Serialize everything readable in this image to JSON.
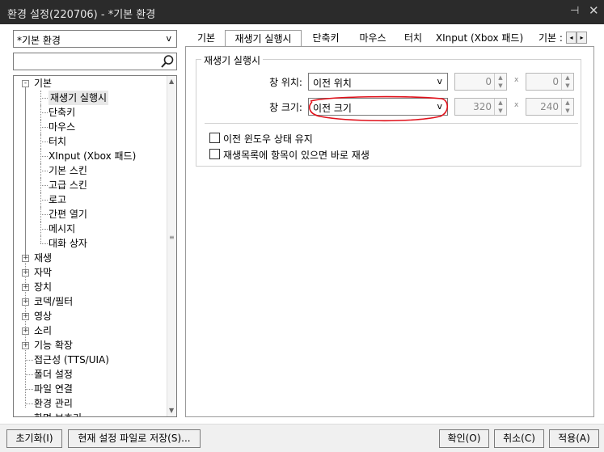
{
  "window": {
    "title": "환경 설정(220706) - *기본 환경",
    "pin_glyph": "⊣",
    "close_glyph": "✕"
  },
  "profile_select": {
    "value": "*기본 환경",
    "arrow": "v"
  },
  "search": {
    "value": "",
    "icon": "search-icon"
  },
  "tree": {
    "root": {
      "toggle": "-",
      "label": "기본"
    },
    "children": [
      "재생기 실행시",
      "단축키",
      "마우스",
      "터치",
      "XInput (Xbox 패드)",
      "기본 스킨",
      "고급 스킨",
      "로고",
      "간편 열기",
      "메시지",
      "대화 상자"
    ],
    "collapsed": [
      "재생",
      "자막",
      "장치",
      "코덱/필터",
      "영상",
      "소리",
      "기능 확장"
    ],
    "leaves": [
      "접근성 (TTS/UIA)",
      "폴더 설정",
      "파일 연결",
      "환경 관리",
      "화면 보호기"
    ],
    "collapsed_toggle": "+",
    "selected": "재생기 실행시"
  },
  "tabs": {
    "items": [
      "기본",
      "재생기 실행시",
      "단축키",
      "마우스",
      "터치",
      "XInput (Xbox 패드)",
      "기본 :"
    ],
    "active": "재생기 실행시",
    "prev": "◂",
    "next": "▸"
  },
  "group": {
    "legend": "재생기 실행시",
    "position_label": "창 위치:",
    "position_value": "이전 위치",
    "size_label": "창 크기:",
    "size_value": "이전 크기",
    "dropdown_arrow": "v",
    "pos_x": "0",
    "pos_y": "0",
    "size_w": "320",
    "size_h": "240",
    "x_sign": "x"
  },
  "checkboxes": [
    {
      "label": "이전 윈도우 상태 유지",
      "checked": false
    },
    {
      "label": "재생목록에 항목이 있으면 바로 재생",
      "checked": false
    }
  ],
  "buttons": {
    "reset": "초기화(I)",
    "save_as": "현재 설정 파일로 저장(S)...",
    "ok": "확인(O)",
    "cancel": "취소(C)",
    "apply": "적용(A)"
  },
  "annotation_color": "#e0101a"
}
